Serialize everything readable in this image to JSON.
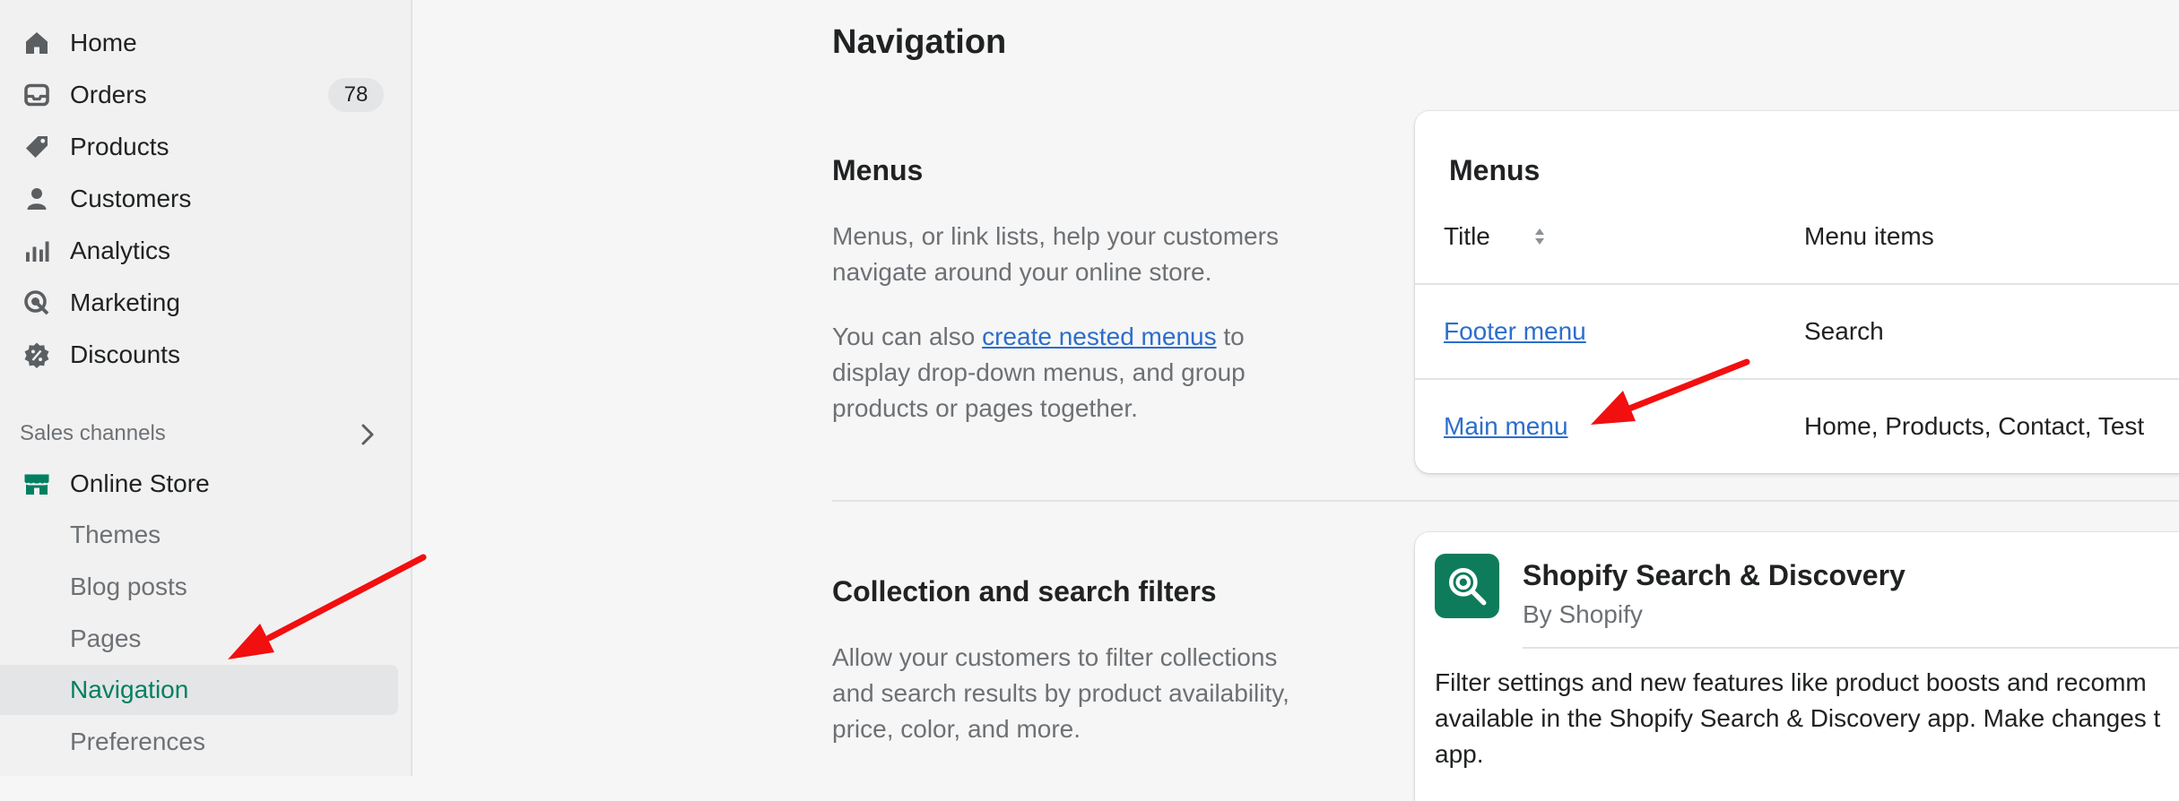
{
  "sidebar": {
    "items": [
      {
        "label": "Home",
        "icon": "home-icon"
      },
      {
        "label": "Orders",
        "icon": "inbox-icon",
        "badge": "78"
      },
      {
        "label": "Products",
        "icon": "tag-icon"
      },
      {
        "label": "Customers",
        "icon": "person-icon"
      },
      {
        "label": "Analytics",
        "icon": "bar-chart-icon"
      },
      {
        "label": "Marketing",
        "icon": "target-icon"
      },
      {
        "label": "Discounts",
        "icon": "discount-icon"
      }
    ],
    "sales_channels_label": "Sales channels",
    "online_store": {
      "label": "Online Store",
      "icon": "store-icon"
    },
    "sub_items": [
      {
        "label": "Themes"
      },
      {
        "label": "Blog posts"
      },
      {
        "label": "Pages"
      },
      {
        "label": "Navigation",
        "active": true
      },
      {
        "label": "Preferences"
      }
    ]
  },
  "main": {
    "title": "Navigation",
    "menus_section": {
      "title": "Menus",
      "desc1": "Menus, or link lists, help your customers navigate around your online store.",
      "desc2_pre": "You can also ",
      "desc2_link": "create nested menus",
      "desc2_post": " to display drop-down menus, and group products or pages together."
    },
    "menus_card": {
      "title": "Menus",
      "columns": [
        "Title",
        "Menu items"
      ],
      "rows": [
        {
          "title": "Footer menu",
          "items": "Search"
        },
        {
          "title": "Main menu",
          "items": "Home, Products, Contact, Test"
        }
      ]
    },
    "filters_section": {
      "title": "Collection and search filters",
      "desc": "Allow your customers to filter collections and search results by product availability, price, color, and more."
    },
    "app_card": {
      "name": "Shopify Search & Discovery",
      "by": "By Shopify",
      "desc": "Filter settings and new features like product boosts and recomm\navailable in the Shopify Search & Discovery app. Make changes t\napp."
    }
  },
  "colors": {
    "accent_green": "#008060",
    "link_blue": "#2c6ecb",
    "annotation_red": "#f20f0f"
  }
}
